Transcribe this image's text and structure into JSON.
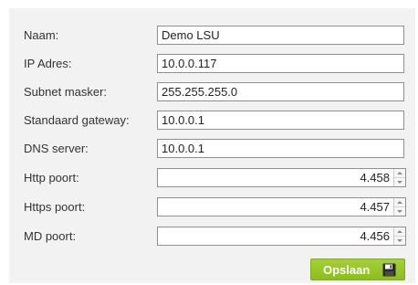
{
  "form": {
    "fields": [
      {
        "label": "Naam:",
        "value": "Demo LSU"
      },
      {
        "label": "IP Adres:",
        "value": "10.0.0.117"
      },
      {
        "label": "Subnet masker:",
        "value": "255.255.255.0"
      },
      {
        "label": "Standaard gateway:",
        "value": "10.0.0.1"
      },
      {
        "label": "DNS server:",
        "value": "10.0.0.1"
      }
    ],
    "ports": [
      {
        "label": "Http poort:",
        "value": "4.458"
      },
      {
        "label": "Https poort:",
        "value": "4.457"
      },
      {
        "label": "MD poort:",
        "value": "4.456"
      }
    ]
  },
  "actions": {
    "save_label": "Opslaan",
    "save_icon": "floppy-disk-icon"
  },
  "colors": {
    "panel_background": "#f2f2f2",
    "save_button": "#96c42a"
  }
}
